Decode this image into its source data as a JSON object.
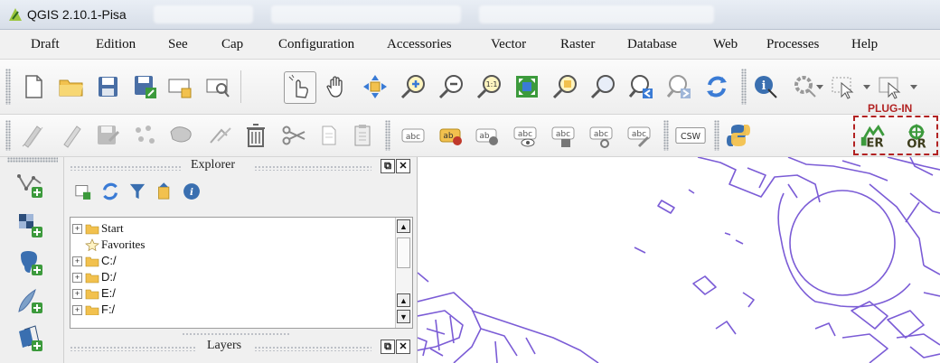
{
  "window": {
    "title": "QGIS 2.10.1-Pisa"
  },
  "menu": [
    "Draft",
    "Edition",
    "See",
    "Cap",
    "Configuration",
    "Accessories",
    "Vector",
    "Raster",
    "Database",
    "Web",
    "Processes",
    "Help"
  ],
  "plugin": {
    "label": "PLUG-IN",
    "border_color": "#b22222"
  },
  "explorer": {
    "title": "Explorer",
    "tree": [
      {
        "label": "Start"
      },
      {
        "label": "Favorites"
      },
      {
        "label": "C:/"
      },
      {
        "label": "D:/"
      },
      {
        "label": "E:/"
      },
      {
        "label": "F:/"
      }
    ]
  },
  "layers": {
    "title": "Layers"
  },
  "toolbar2_text_icons": {
    "csw": "CSW",
    "abc": "abc",
    "ab": "ab"
  },
  "colors": {
    "map_line": "#7b5cd6",
    "folder": "#f2c14e",
    "accent_green": "#3c9a3c"
  }
}
